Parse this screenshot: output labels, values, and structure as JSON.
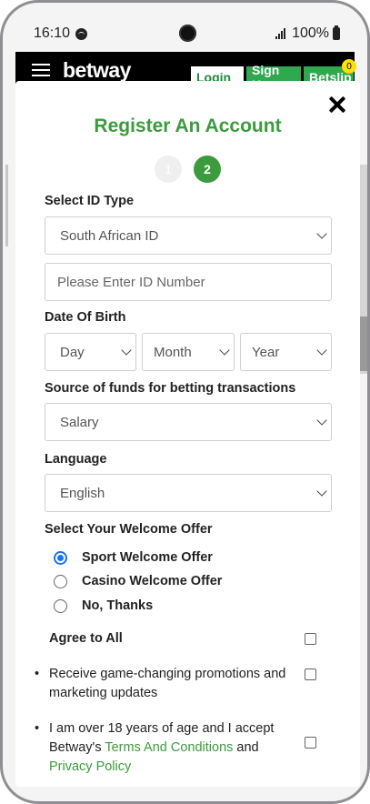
{
  "status_bar": {
    "time": "16:10",
    "battery": "100%"
  },
  "header": {
    "logo": "betway",
    "login": "Login",
    "signup": "Sign Up",
    "betslip": "Betslip",
    "betslip_count": "0"
  },
  "modal": {
    "title": "Register An Account",
    "steps": [
      "1",
      "2"
    ],
    "id_type": {
      "label": "Select ID Type",
      "value": "South African ID"
    },
    "id_number": {
      "placeholder": "Please Enter ID Number"
    },
    "dob": {
      "label": "Date Of Birth",
      "day": "Day",
      "month": "Month",
      "year": "Year"
    },
    "funds": {
      "label": "Source of funds for betting transactions",
      "value": "Salary"
    },
    "language": {
      "label": "Language",
      "value": "English"
    },
    "welcome_offer": {
      "label": "Select Your Welcome Offer",
      "options": [
        "Sport Welcome Offer",
        "Casino Welcome Offer",
        "No, Thanks"
      ],
      "selected": "Sport Welcome Offer"
    },
    "agree": {
      "all": "Agree to All",
      "promo": "Receive game-changing promotions and marketing updates",
      "age_prefix": "I am over 18 years of age and I accept Betway's ",
      "terms_link": "Terms And Conditions",
      "and": " and ",
      "privacy_link": "Privacy Policy"
    }
  },
  "colors": {
    "brand_green": "#3c9b3c",
    "radio_blue": "#1a73e8"
  },
  "icons": [
    "spotify-icon",
    "camera-icon",
    "signal-icon",
    "battery-icon",
    "menu-icon",
    "close-icon",
    "chevron-down-icon"
  ]
}
